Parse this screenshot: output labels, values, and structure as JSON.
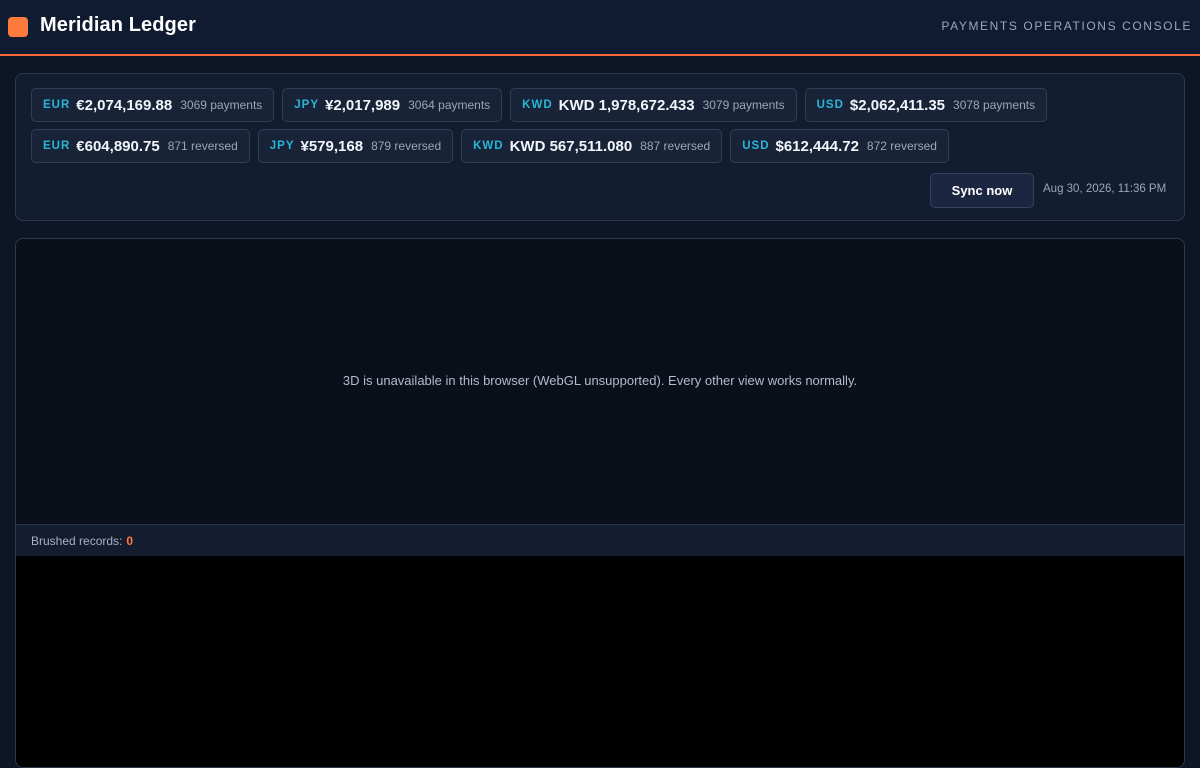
{
  "header": {
    "title": "Meridian Ledger",
    "subtitle": "PAYMENTS OPERATIONS CONSOLE",
    "accent_color": "#f26b38"
  },
  "summary": {
    "payments": [
      {
        "code": "EUR",
        "amount": "€2,074,169.88",
        "count": "3069 payments"
      },
      {
        "code": "JPY",
        "amount": "¥2,017,989",
        "count": "3064 payments"
      },
      {
        "code": "KWD",
        "amount": "KWD 1,978,672.433",
        "count": "3079 payments"
      },
      {
        "code": "USD",
        "amount": "$2,062,411.35",
        "count": "3078 payments"
      }
    ],
    "reversals": [
      {
        "code": "EUR",
        "amount": "€604,890.75",
        "count": "871 reversed"
      },
      {
        "code": "JPY",
        "amount": "¥579,168",
        "count": "879 reversed"
      },
      {
        "code": "KWD",
        "amount": "KWD 567,511.080",
        "count": "887 reversed"
      },
      {
        "code": "USD",
        "amount": "$612,444.72",
        "count": "872 reversed"
      }
    ],
    "sync_label": "Sync now",
    "sync_time": "Aug 30, 2026, 11:36 PM"
  },
  "view": {
    "webgl_message": "3D is unavailable in this browser (WebGL unsupported). Every other view works normally.",
    "brush_label": "Brushed records:",
    "brush_count": "0"
  }
}
